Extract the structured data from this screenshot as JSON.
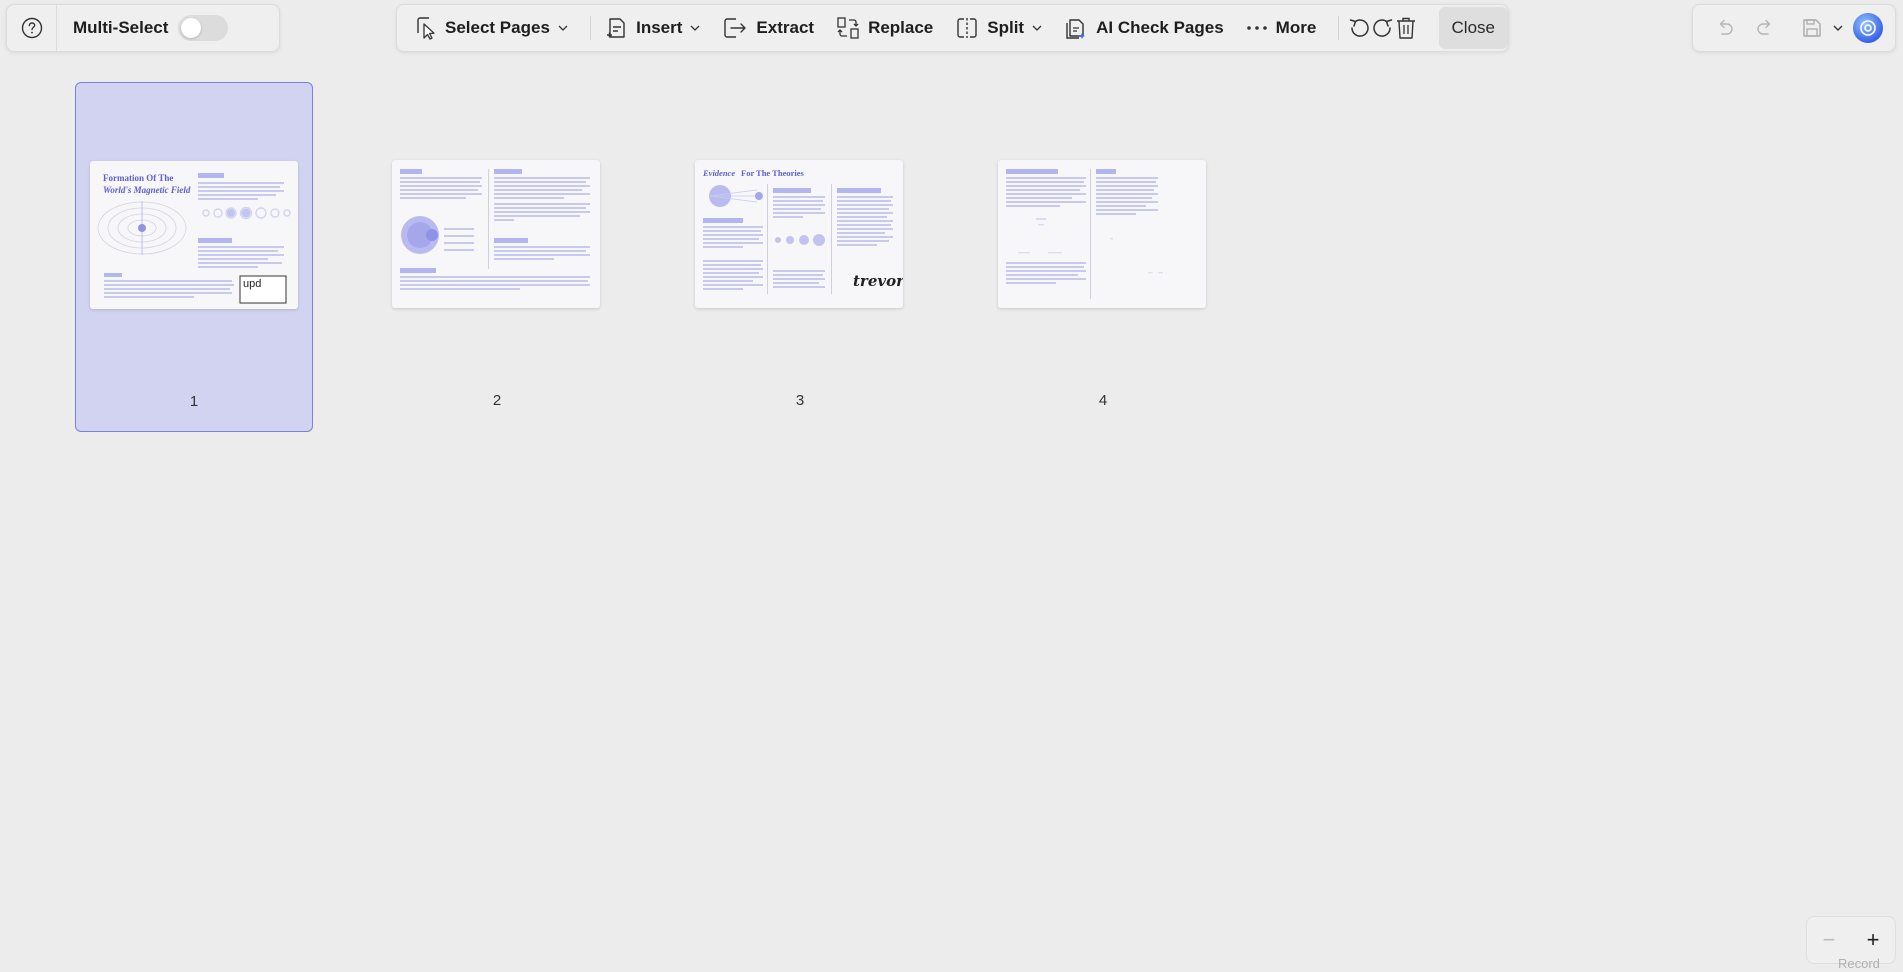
{
  "left_panel": {
    "help_icon": "question-circle-icon",
    "multi_select_label": "Multi-Select",
    "multi_select_on": false
  },
  "toolbar": {
    "select_pages": "Select Pages",
    "insert": "Insert",
    "extract": "Extract",
    "replace": "Replace",
    "split": "Split",
    "ai_check_pages": "AI Check Pages",
    "more": "More",
    "close": "Close"
  },
  "pages": [
    {
      "number": "1",
      "selected": true
    },
    {
      "number": "2",
      "selected": false
    },
    {
      "number": "3",
      "selected": false
    },
    {
      "number": "4",
      "selected": false
    }
  ],
  "thumbnails": {
    "page1_title_line1": "Formation Of The",
    "page1_title_line2": "World's Magnetic Field",
    "page1_logo": "upd",
    "page3_title_italic": "Evidence",
    "page3_title_bold": "For The Theories",
    "page3_signature": "trevor"
  },
  "zoom": {
    "minus": "−",
    "plus": "+"
  },
  "record_label": "Record",
  "colors": {
    "accent": "#5b5fd3",
    "selection_bg": "#d2d3f1",
    "selection_border": "#7c7fe6",
    "background": "#ececec"
  }
}
